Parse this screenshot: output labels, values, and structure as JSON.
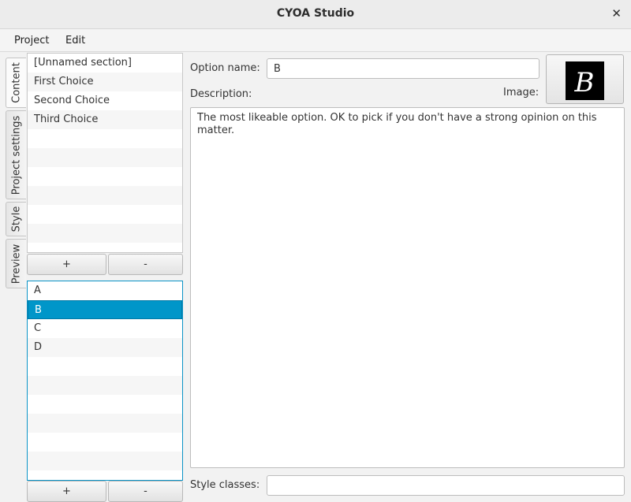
{
  "window": {
    "title": "CYOA Studio",
    "close_glyph": "✕"
  },
  "menu": {
    "project": "Project",
    "edit": "Edit"
  },
  "side_tabs": {
    "content": "Content",
    "project_settings": "Project settings",
    "style": "Style",
    "preview": "Preview"
  },
  "sections": {
    "items": [
      "[Unnamed section]",
      "First Choice",
      "Second Choice",
      "Third Choice"
    ],
    "add_label": "+",
    "remove_label": "-"
  },
  "options": {
    "items": [
      "A",
      "B",
      "C",
      "D"
    ],
    "selected": "B",
    "add_label": "+",
    "remove_label": "-"
  },
  "editor": {
    "option_name_label": "Option name:",
    "option_name_value": "B",
    "image_label": "Image:",
    "image_glyph": "B",
    "description_label": "Description:",
    "description_text": "The most likeable option. OK to pick if you don't have a strong opinion on this matter.",
    "style_classes_label": "Style classes:",
    "style_classes_value": ""
  },
  "colors": {
    "selection": "#0096c9",
    "focus_border": "#0a93c6"
  }
}
